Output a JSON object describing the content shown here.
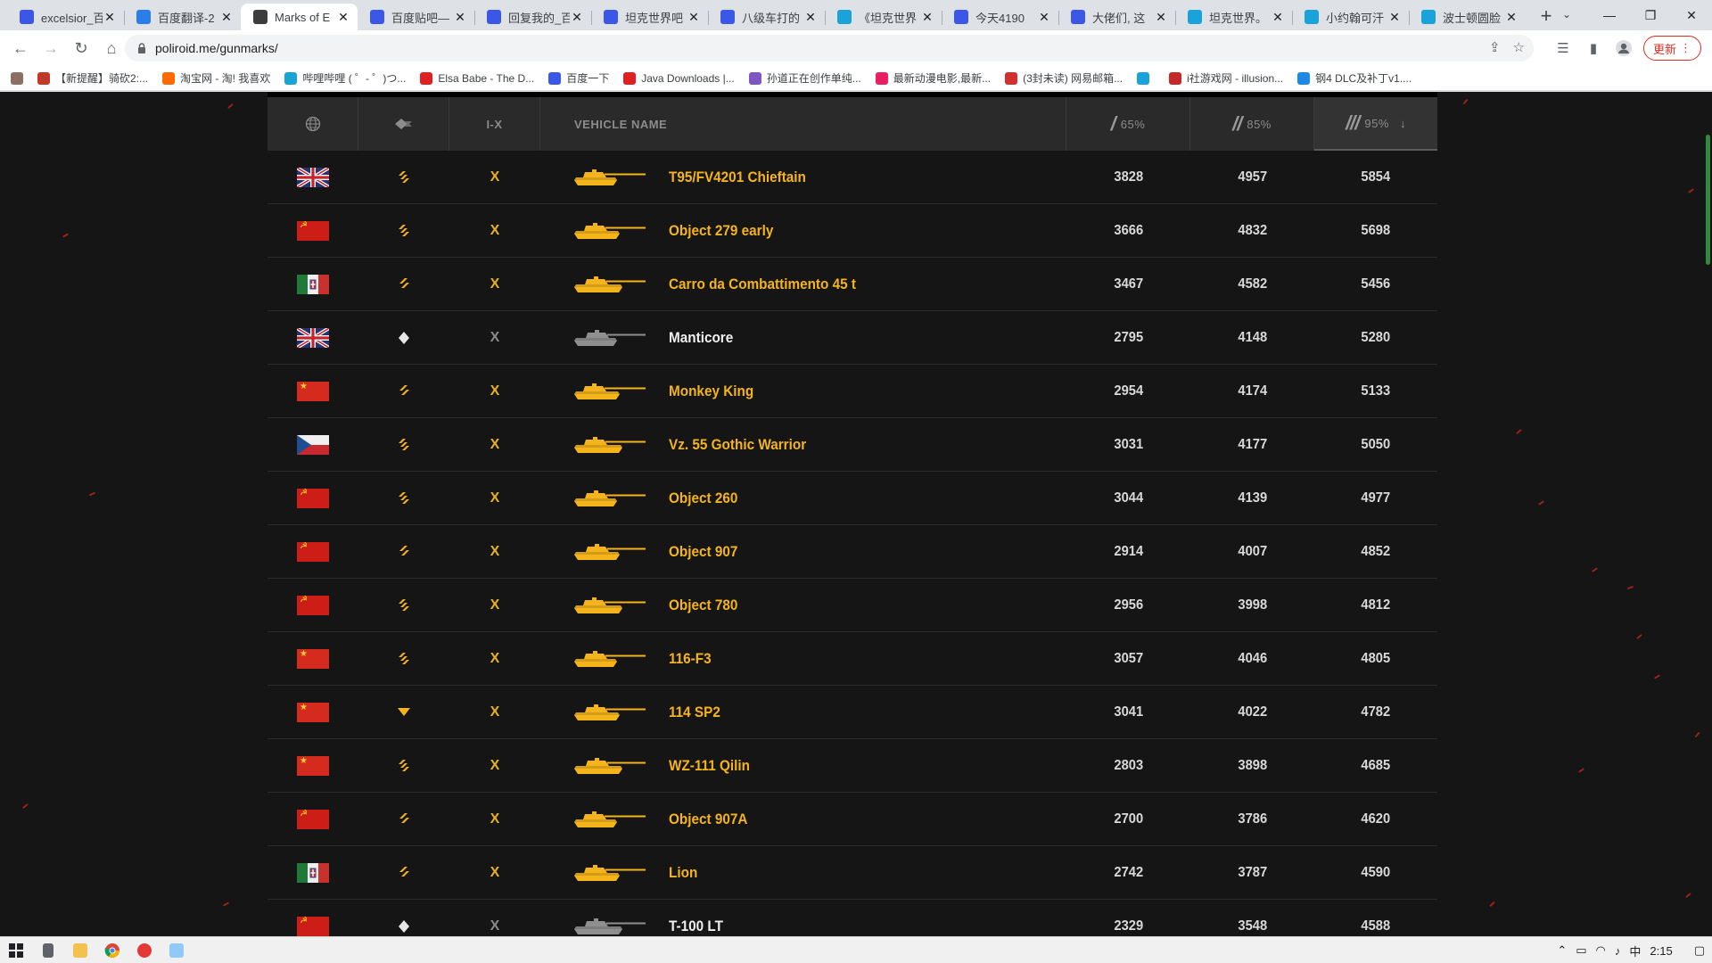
{
  "browser": {
    "tabs": [
      {
        "title": "excelsior_百",
        "favicon_color": "#3a57e8",
        "favicon_glyph": "🐾"
      },
      {
        "title": "百度翻译-2",
        "favicon_color": "#2b7de9",
        "favicon_glyph": "译"
      },
      {
        "title": "Marks of E",
        "favicon_color": "#3c3c3c",
        "favicon_glyph": "⛊",
        "active": true
      },
      {
        "title": "百度贴吧—",
        "favicon_color": "#3a57e8",
        "favicon_glyph": "🐾"
      },
      {
        "title": "回复我的_百",
        "favicon_color": "#3a57e8",
        "favicon_glyph": "🐾"
      },
      {
        "title": "坦克世界吧",
        "favicon_color": "#3a57e8",
        "favicon_glyph": "🐾"
      },
      {
        "title": "八级车打的",
        "favicon_color": "#3a57e8",
        "favicon_glyph": "🐾"
      },
      {
        "title": "《坦克世界",
        "favicon_color": "#1aa3d9",
        "favicon_glyph": "📺"
      },
      {
        "title": "今天4190",
        "favicon_color": "#3a57e8",
        "favicon_glyph": "🐾"
      },
      {
        "title": "大佬们, 这",
        "favicon_color": "#3a57e8",
        "favicon_glyph": "🐾"
      },
      {
        "title": "坦克世界。",
        "favicon_color": "#1aa3d9",
        "favicon_glyph": "📺"
      },
      {
        "title": "小约翰可汗",
        "favicon_color": "#1aa3d9",
        "favicon_glyph": "📺"
      },
      {
        "title": "波士顿圆脸",
        "favicon_color": "#1aa3d9",
        "favicon_glyph": "📺"
      }
    ],
    "new_tab": "+",
    "url": "poliroid.me/gunmarks/",
    "update_label": "更新",
    "bookmarks": [
      {
        "label": "【新提醒】骑砍2:...",
        "color": "#c0392b"
      },
      {
        "label": "淘宝网 - 淘! 我喜欢",
        "color": "#ff6a00"
      },
      {
        "label": "哔哩哔哩 ( ゜- ゜)つ...",
        "color": "#1aa3d9"
      },
      {
        "label": "Elsa Babe - The D...",
        "color": "#e02020"
      },
      {
        "label": "百度一下",
        "color": "#3a57e8"
      },
      {
        "label": "Java Downloads |...",
        "color": "#e02020"
      },
      {
        "label": "孙道正在创作单纯...",
        "color": "#7e57c2"
      },
      {
        "label": "最新动漫电影,最新...",
        "color": "#e91e63"
      },
      {
        "label": "(3封未读) 网易邮箱...",
        "color": "#d32f2f"
      },
      {
        "label": "",
        "color": "#1aa3d9"
      },
      {
        "label": "i社游戏网 - illusion...",
        "color": "#c62828"
      },
      {
        "label": "钢4 DLC及补丁v1....",
        "color": "#1e88e5"
      }
    ]
  },
  "table": {
    "headers": {
      "nation": "globe-icon",
      "class": "tank-class-icon",
      "tier": "I-X",
      "vehicle": "VEHICLE NAME",
      "mark1_slash": "/",
      "mark1_pct": "65%",
      "mark2_slash": "//",
      "mark2_pct": "85%",
      "mark3_slash": "///",
      "mark3_pct": "95%",
      "sort_arrow": "↓"
    },
    "rows": [
      {
        "nation": "uk",
        "class": "heavy",
        "tier": "X",
        "name": "T95/FV4201 Chieftain",
        "premium": false,
        "m1": "3828",
        "m2": "4957",
        "m3": "5854"
      },
      {
        "nation": "ussr",
        "class": "heavy",
        "tier": "X",
        "name": "Object 279 early",
        "premium": false,
        "m1": "3666",
        "m2": "4832",
        "m3": "5698"
      },
      {
        "nation": "italy",
        "class": "medium",
        "tier": "X",
        "name": "Carro da Combattimento 45 t",
        "premium": false,
        "m1": "3467",
        "m2": "4582",
        "m3": "5456"
      },
      {
        "nation": "uk",
        "class": "light",
        "tier": "X",
        "name": "Manticore",
        "premium": true,
        "m1": "2795",
        "m2": "4148",
        "m3": "5280"
      },
      {
        "nation": "china",
        "class": "medium",
        "tier": "X",
        "name": "Monkey King",
        "premium": false,
        "m1": "2954",
        "m2": "4174",
        "m3": "5133"
      },
      {
        "nation": "czech",
        "class": "heavy",
        "tier": "X",
        "name": "Vz. 55 Gothic Warrior",
        "premium": false,
        "m1": "3031",
        "m2": "4177",
        "m3": "5050"
      },
      {
        "nation": "ussr",
        "class": "heavy",
        "tier": "X",
        "name": "Object 260",
        "premium": false,
        "m1": "3044",
        "m2": "4139",
        "m3": "4977"
      },
      {
        "nation": "ussr",
        "class": "medium",
        "tier": "X",
        "name": "Object 907",
        "premium": false,
        "m1": "2914",
        "m2": "4007",
        "m3": "4852"
      },
      {
        "nation": "ussr",
        "class": "heavy",
        "tier": "X",
        "name": "Object 780",
        "premium": false,
        "m1": "2956",
        "m2": "3998",
        "m3": "4812"
      },
      {
        "nation": "china",
        "class": "heavy",
        "tier": "X",
        "name": "116-F3",
        "premium": false,
        "m1": "3057",
        "m2": "4046",
        "m3": "4805"
      },
      {
        "nation": "china",
        "class": "td",
        "tier": "X",
        "name": "114 SP2",
        "premium": false,
        "m1": "3041",
        "m2": "4022",
        "m3": "4782"
      },
      {
        "nation": "china",
        "class": "heavy",
        "tier": "X",
        "name": "WZ-111 Qilin",
        "premium": false,
        "m1": "2803",
        "m2": "3898",
        "m3": "4685"
      },
      {
        "nation": "ussr",
        "class": "medium",
        "tier": "X",
        "name": "Object 907A",
        "premium": false,
        "m1": "2700",
        "m2": "3786",
        "m3": "4620"
      },
      {
        "nation": "italy",
        "class": "medium",
        "tier": "X",
        "name": "Lion",
        "premium": false,
        "m1": "2742",
        "m2": "3787",
        "m3": "4590"
      },
      {
        "nation": "ussr",
        "class": "light",
        "tier": "X",
        "name": "T-100 LT",
        "premium": true,
        "m1": "2329",
        "m2": "3548",
        "m3": "4588"
      }
    ]
  },
  "colors": {
    "accent": "#f4b41a",
    "page_bg": "#151515",
    "header_bg": "#2a2a2a",
    "premium_name": "#f0f0f0",
    "standard_icon": "#9a9a9a"
  },
  "taskbar": {
    "time": "2:15",
    "ime": "中"
  }
}
